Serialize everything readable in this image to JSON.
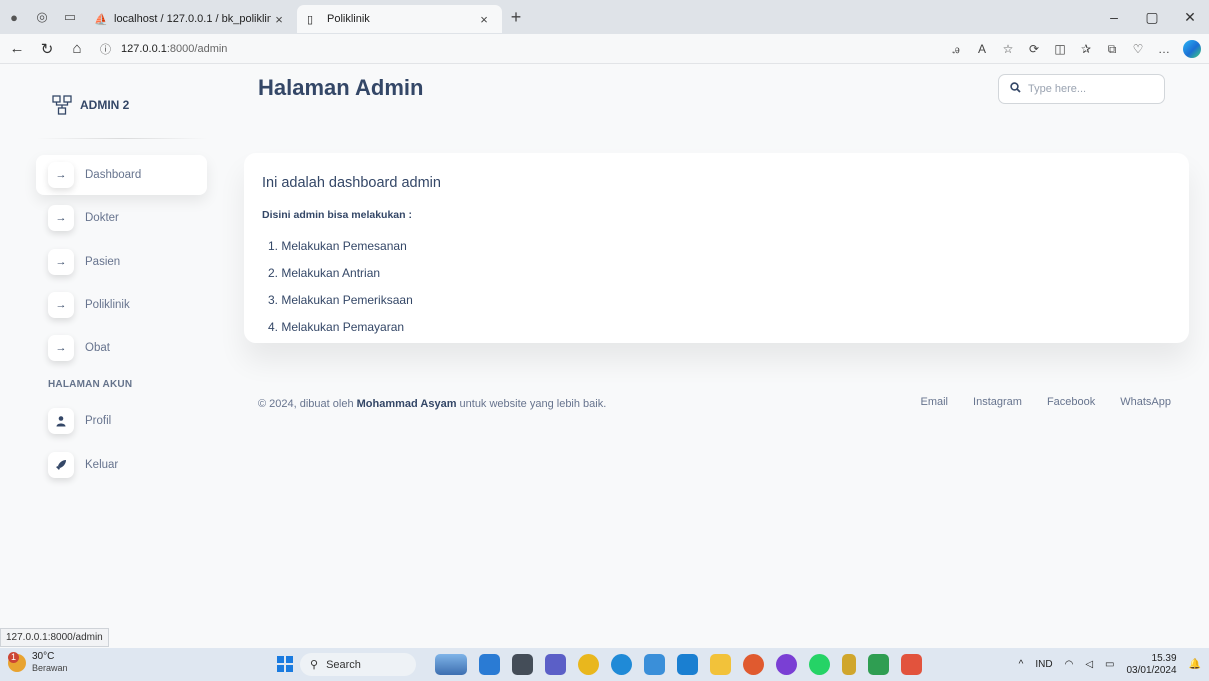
{
  "browser": {
    "tabs": [
      {
        "label": "localhost / 127.0.0.1 / bk_poliklin",
        "active": false
      },
      {
        "label": "Poliklinik",
        "active": true
      }
    ],
    "address": {
      "host": "127.0.0.1",
      "rest": ":8000/admin"
    },
    "status_url": "127.0.0.1:8000/admin"
  },
  "sidebar": {
    "brand": "ADMIN 2",
    "items": [
      {
        "label": "Dashboard",
        "icon": "arrow-right-icon",
        "glyph": "→",
        "active": true
      },
      {
        "label": "Dokter",
        "icon": "arrow-right-icon",
        "glyph": "→",
        "active": false
      },
      {
        "label": "Pasien",
        "icon": "arrow-right-icon",
        "glyph": "→",
        "active": false
      },
      {
        "label": "Poliklinik",
        "icon": "arrow-right-icon",
        "glyph": "→",
        "active": false
      },
      {
        "label": "Obat",
        "icon": "arrow-right-icon",
        "glyph": "→",
        "active": false
      }
    ],
    "account_heading": "HALAMAN AKUN",
    "account_items": [
      {
        "label": "Profil",
        "icon": "user-icon",
        "glyph": "👤"
      },
      {
        "label": "Keluar",
        "icon": "rocket-icon",
        "glyph": "🚀"
      }
    ]
  },
  "header": {
    "title": "Halaman Admin",
    "search_placeholder": "Type here..."
  },
  "card": {
    "title": "Ini adalah dashboard admin",
    "subtitle": "Disini admin bisa melakukan :",
    "list": [
      "1. Melakukan Pemesanan",
      "2. Melakukan Antrian",
      "3. Melakukan Pemeriksaan",
      "4. Melakukan Pemayaran"
    ]
  },
  "footer": {
    "copy_prefix": "© 2024, dibuat oleh ",
    "author": "Mohammad Asyam",
    "copy_suffix": " untuk website yang lebih baik.",
    "links": [
      "Email",
      "Instagram",
      "Facebook",
      "WhatsApp"
    ]
  },
  "taskbar": {
    "weather_temp": "30°C",
    "weather_desc": "Berawan",
    "search_label": "Search",
    "language": "IND",
    "time": "15.39",
    "date": "03/01/2024"
  },
  "colors": {
    "primary_text": "#344767",
    "secondary_text": "#67748e",
    "page_bg": "#f8f9fa"
  }
}
